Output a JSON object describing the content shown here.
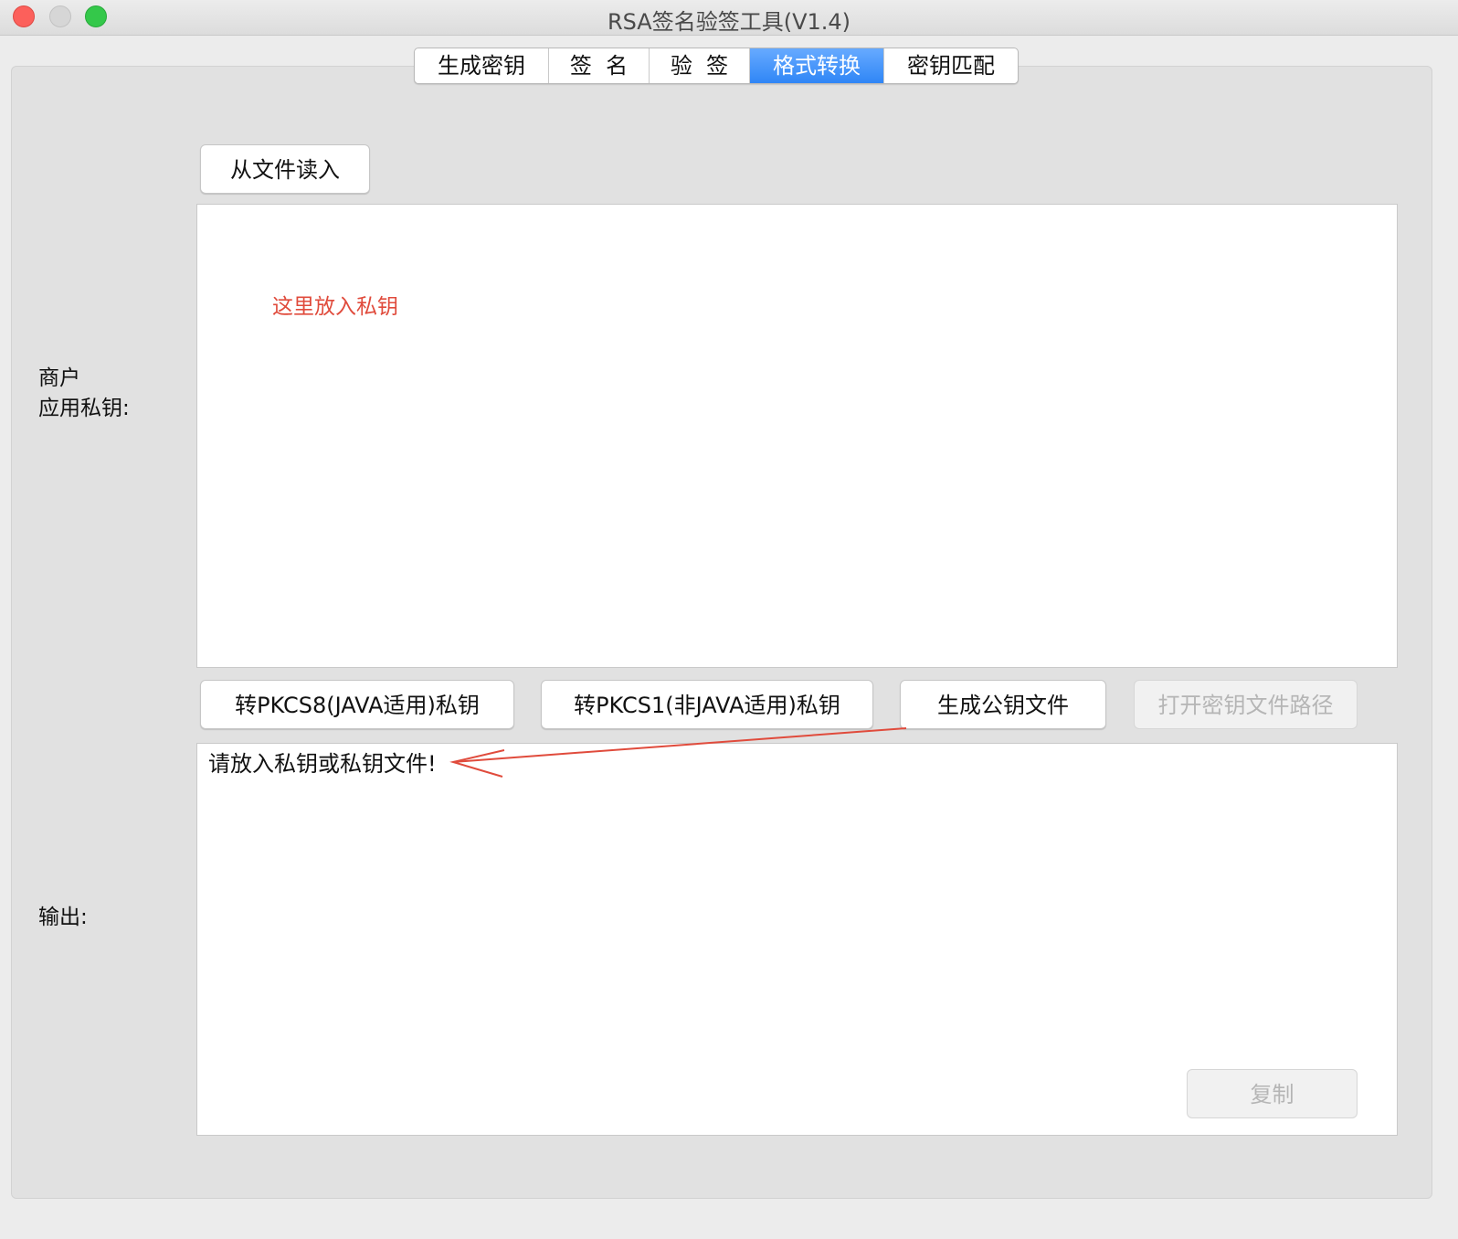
{
  "window": {
    "title": "RSA签名验签工具(V1.4)"
  },
  "tabs": [
    {
      "label": "生成密钥",
      "active": false
    },
    {
      "label": "签  名",
      "active": false
    },
    {
      "label": "验  签",
      "active": false
    },
    {
      "label": "格式转换",
      "active": true
    },
    {
      "label": "密钥匹配",
      "active": false
    }
  ],
  "buttons": {
    "read_file": "从文件读入",
    "to_pkcs8": "转PKCS8(JAVA适用)私钥",
    "to_pkcs1": "转PKCS1(非JAVA适用)私钥",
    "gen_public": "生成公钥文件",
    "open_path": "打开密钥文件路径",
    "copy": "复制"
  },
  "labels": {
    "private_key_line1": "商户",
    "private_key_line2": "应用私钥:",
    "output": "输出:"
  },
  "private_key_input": {
    "value": "",
    "annotation": "这里放入私钥"
  },
  "output": {
    "text": "请放入私钥或私钥文件!"
  },
  "colors": {
    "accent": "#2f86f6",
    "annotation": "#e04b3c"
  }
}
